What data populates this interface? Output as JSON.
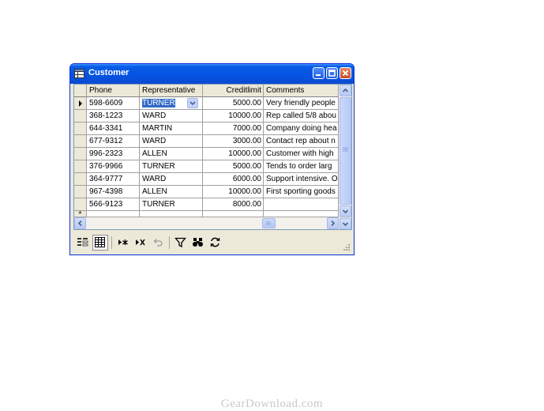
{
  "window": {
    "title": "Customer"
  },
  "grid": {
    "headers": [
      "Phone",
      "Representative",
      "Creditlimit",
      "Comments"
    ],
    "rows": [
      {
        "phone": "598-6609",
        "rep": "TURNER",
        "credit": "5000.00",
        "comments": "Very friendly people"
      },
      {
        "phone": "368-1223",
        "rep": "WARD",
        "credit": "10000.00",
        "comments": "Rep called 5/8 abou"
      },
      {
        "phone": "644-3341",
        "rep": "MARTIN",
        "credit": "7000.00",
        "comments": "Company doing hea"
      },
      {
        "phone": "677-9312",
        "rep": "WARD",
        "credit": "3000.00",
        "comments": "Contact rep about n"
      },
      {
        "phone": "996-2323",
        "rep": "ALLEN",
        "credit": "10000.00",
        "comments": "Customer with high"
      },
      {
        "phone": "376-9966",
        "rep": "TURNER",
        "credit": "5000.00",
        "comments": "Tends to order larg"
      },
      {
        "phone": "364-9777",
        "rep": "WARD",
        "credit": "6000.00",
        "comments": "Support intensive. O"
      },
      {
        "phone": "967-4398",
        "rep": "ALLEN",
        "credit": "10000.00",
        "comments": "First sporting goods"
      },
      {
        "phone": "566-9123",
        "rep": "TURNER",
        "credit": "8000.00",
        "comments": ""
      }
    ],
    "new_row_marker": "*"
  },
  "toolbar": {
    "items": [
      "form-view-icon",
      "grid-view-icon",
      "add-record-icon",
      "delete-record-icon",
      "undo-icon",
      "filter-icon",
      "find-icon",
      "refresh-icon"
    ]
  },
  "watermark": "GearDownload.com"
}
